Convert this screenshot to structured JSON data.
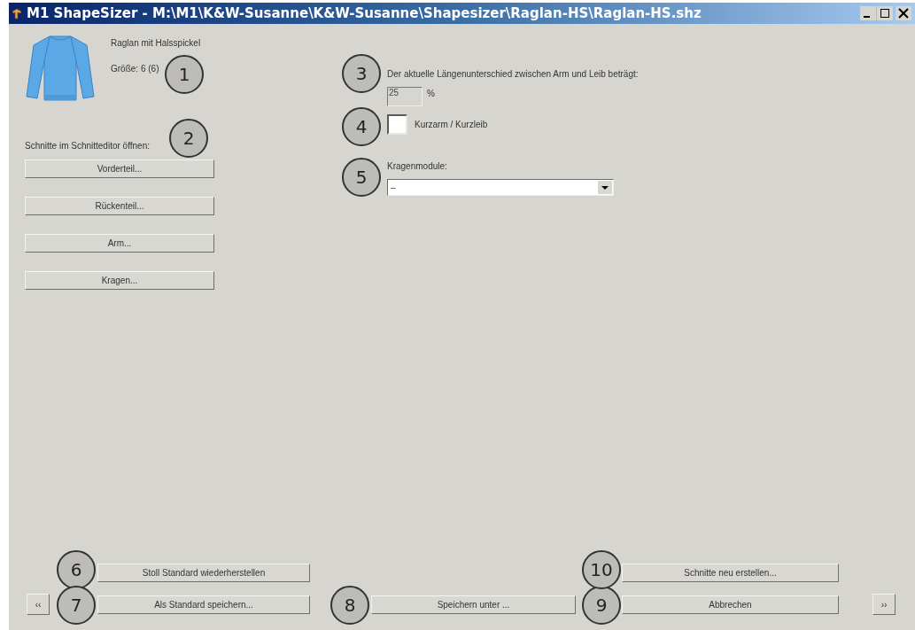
{
  "window": {
    "title": "M1 ShapeSizer - M:\\M1\\K&W-Susanne\\K&W-Susanne\\Shapesizer\\Raglan-HS\\Raglan-HS.shz"
  },
  "garment": {
    "name": "Raglan mit Halsspickel",
    "size": "Größe: 6 (6)"
  },
  "editor": {
    "label": "Schnitte im Schnitteditor öffnen:",
    "buttons": [
      "Vorderteil...",
      "Rückenteil...",
      "Arm...",
      "Kragen..."
    ]
  },
  "length_difference": {
    "label": "Der aktuelle Längenunterschied zwischen Arm und Leib beträgt:",
    "value": "25",
    "unit": "%"
  },
  "short_option": {
    "label": "Kurzarm / Kurzleib",
    "checked": false
  },
  "collar": {
    "label": "Kragenmodule:",
    "value": "–"
  },
  "footer": {
    "restore": "Stoll Standard wiederherstellen",
    "save_default": "Als Standard speichern...",
    "save_as": "Speichern unter ...",
    "regenerate": "Schnitte neu erstellen...",
    "cancel": "Abbrechen",
    "prev": "‹‹",
    "next": "››"
  },
  "callouts": [
    "1",
    "2",
    "3",
    "4",
    "5",
    "6",
    "7",
    "8",
    "9",
    "10"
  ]
}
